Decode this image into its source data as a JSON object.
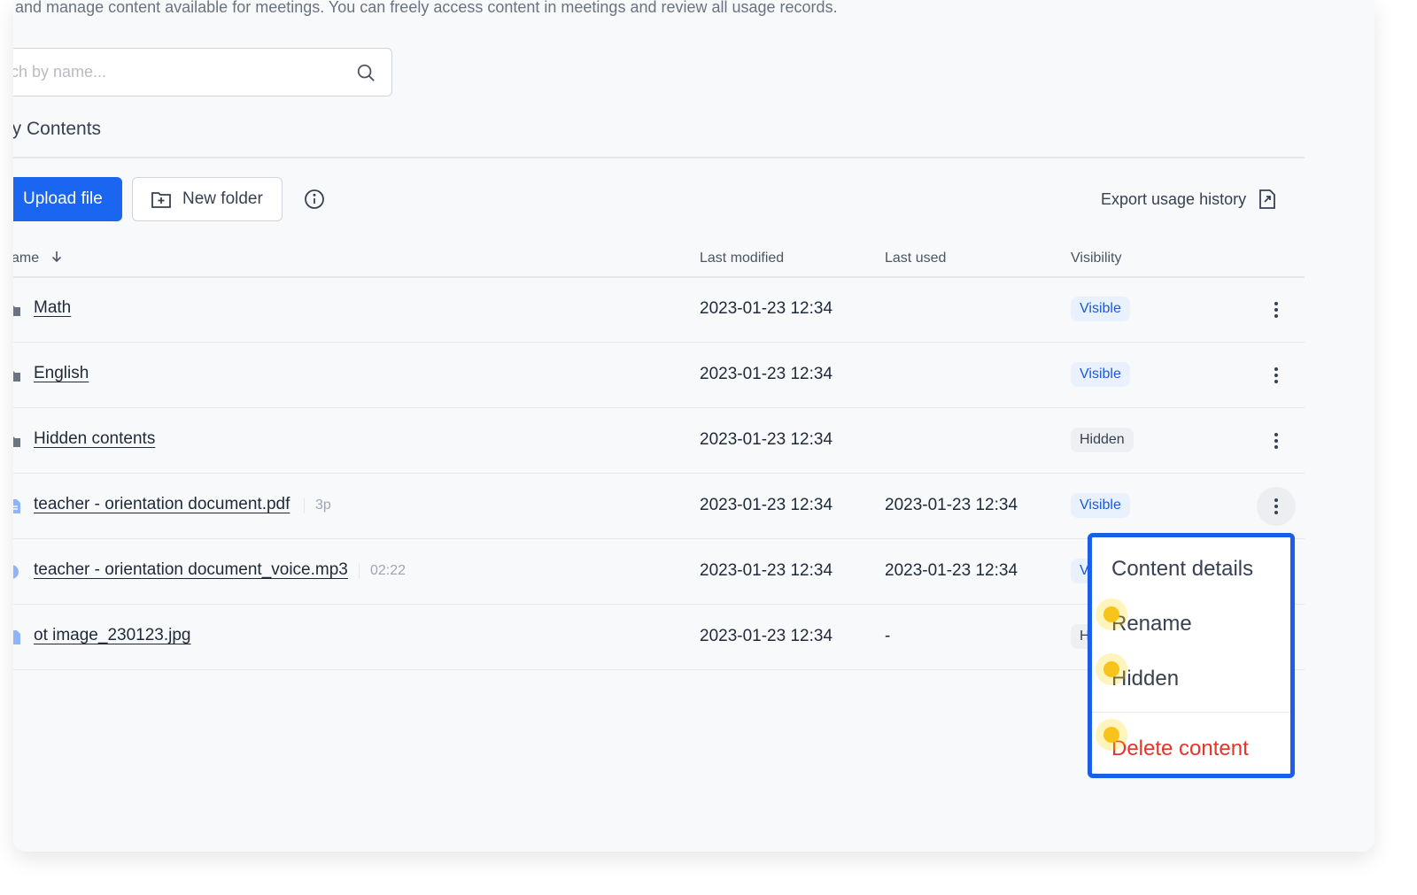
{
  "description": "d and manage content available for meetings. You can freely access content in meetings and review all usage records.",
  "search": {
    "placeholder": "rch by name..."
  },
  "section_title": "ly Contents",
  "toolbar": {
    "upload_label": "Upload file",
    "new_folder_label": "New folder",
    "export_label": "Export usage history"
  },
  "table": {
    "headers": {
      "name": "ame",
      "last_modified": "Last modified",
      "last_used": "Last used",
      "visibility": "Visibility"
    },
    "rows": [
      {
        "type": "folder",
        "name": "Math",
        "meta": "",
        "last_modified": "2023-01-23 12:34",
        "last_used": "",
        "visibility": "Visible"
      },
      {
        "type": "folder",
        "name": "English",
        "meta": "",
        "last_modified": "2023-01-23 12:34",
        "last_used": "",
        "visibility": "Visible"
      },
      {
        "type": "folder",
        "name": "Hidden contents",
        "meta": "",
        "last_modified": "2023-01-23 12:34",
        "last_used": "",
        "visibility": "Hidden"
      },
      {
        "type": "pdf",
        "name": "teacher - orientation document.pdf",
        "meta": "3p",
        "last_modified": "2023-01-23 12:34",
        "last_used": "2023-01-23 12:34",
        "visibility": "Visible"
      },
      {
        "type": "audio",
        "name": "teacher - orientation document_voice.mp3",
        "meta": "02:22",
        "last_modified": "2023-01-23 12:34",
        "last_used": "2023-01-23 12:34",
        "visibility": "V"
      },
      {
        "type": "image",
        "name": "ot image_230123.jpg",
        "meta": "",
        "last_modified": "2023-01-23 12:34",
        "last_used": "-",
        "visibility": "H"
      }
    ]
  },
  "context_menu": {
    "items": [
      "Content details",
      "Rename",
      "Hidden"
    ],
    "danger_item": "Delete content"
  },
  "colors": {
    "accent": "#1a66f0",
    "danger": "#e5342a",
    "highlight_dot": "#f8c31a"
  },
  "icons": {
    "search": "search-icon",
    "folder_add": "folder-add-icon",
    "info": "info-icon",
    "export": "export-file-icon",
    "more": "more-vertical-icon",
    "sort": "sort-arrow-down-icon"
  }
}
